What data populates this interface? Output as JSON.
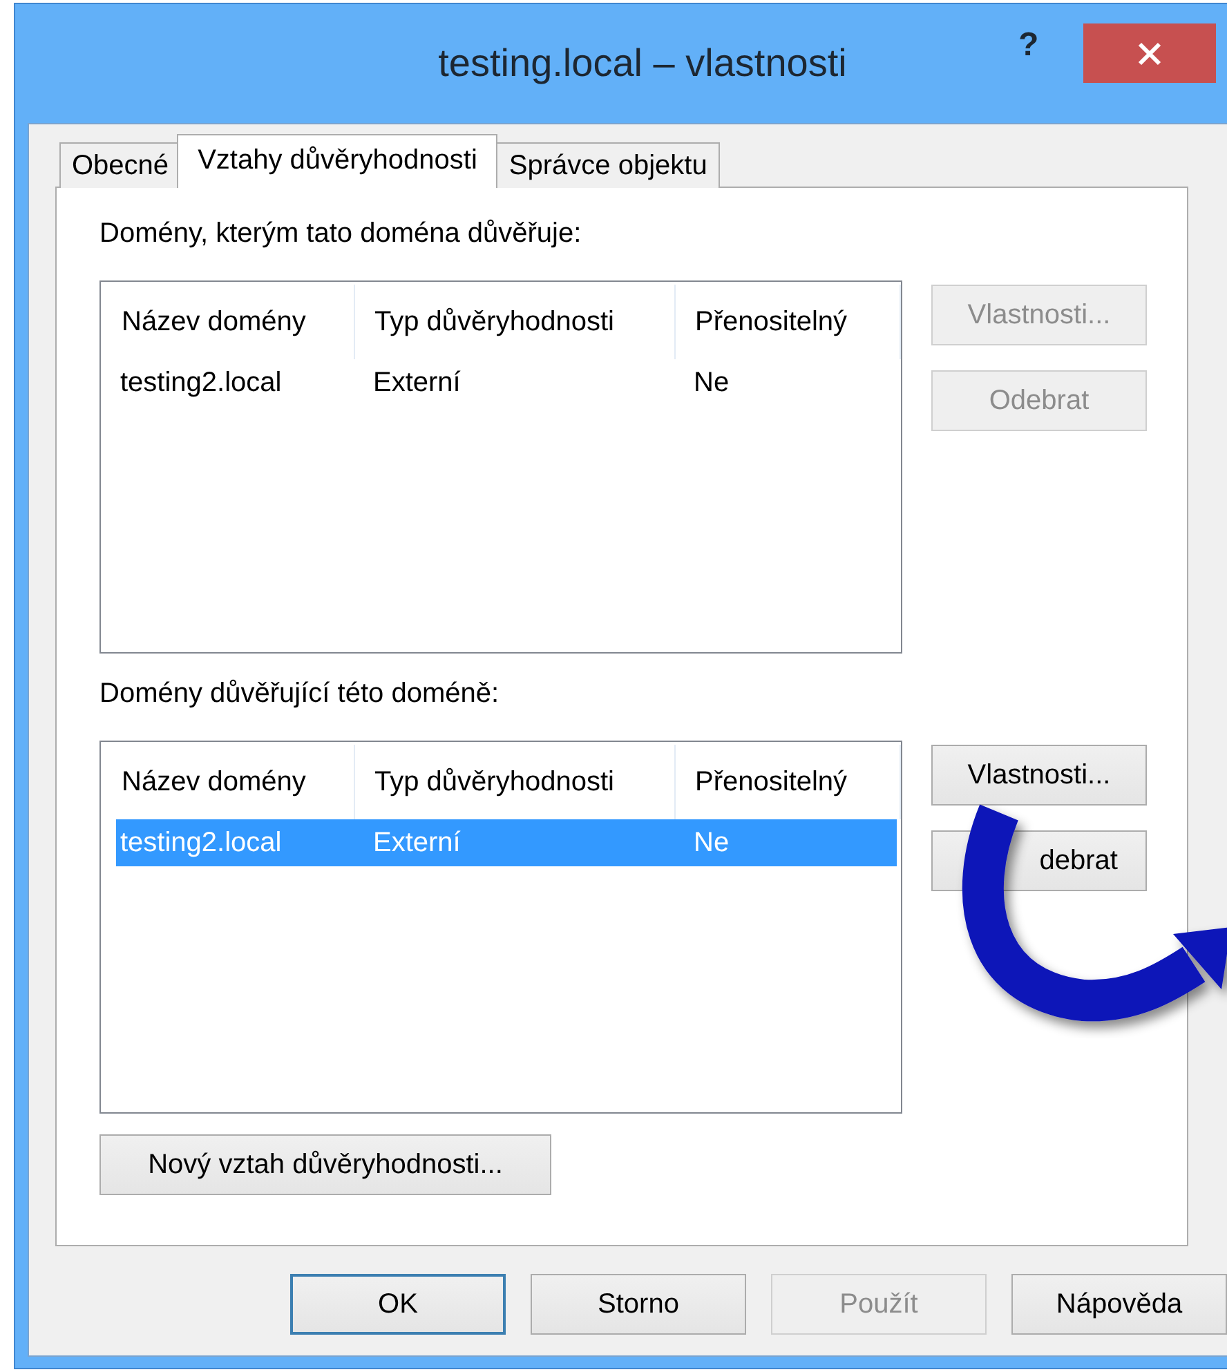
{
  "window": {
    "title": "testing.local – vlastnosti",
    "help": "?"
  },
  "tabs": [
    {
      "label": "Obecné",
      "selected": false
    },
    {
      "label": "Vztahy důvěryhodnosti",
      "selected": true
    },
    {
      "label": "Správce objektu",
      "selected": false
    }
  ],
  "sections": [
    {
      "label": "Domény, kterým tato doména důvěřuje:",
      "columns": [
        "Název domény",
        "Typ důvěryhodnosti",
        "Přenositelný"
      ],
      "rows": [
        {
          "cells": [
            "testing2.local",
            "Externí",
            "Ne"
          ],
          "selected": false
        }
      ],
      "buttons": [
        {
          "label": "Vlastnosti...",
          "disabled": true
        },
        {
          "label": "Odebrat",
          "disabled": true
        }
      ]
    },
    {
      "label": "Domény důvěřující této doméně:",
      "columns": [
        "Název domény",
        "Typ důvěryhodnosti",
        "Přenositelný"
      ],
      "rows": [
        {
          "cells": [
            "testing2.local",
            "Externí",
            "Ne"
          ],
          "selected": true
        }
      ],
      "buttons": [
        {
          "label": "Vlastnosti...",
          "disabled": false
        },
        {
          "label": "debrat",
          "disabled": false
        }
      ]
    }
  ],
  "new_trust_button": "Nový vztah důvěryhodnosti...",
  "footer_buttons": [
    {
      "label": "OK",
      "disabled": false,
      "kind": "default"
    },
    {
      "label": "Storno",
      "disabled": false,
      "kind": "normal"
    },
    {
      "label": "Použít",
      "disabled": true,
      "kind": "normal"
    },
    {
      "label": "Nápověda",
      "disabled": false,
      "kind": "normal"
    }
  ]
}
